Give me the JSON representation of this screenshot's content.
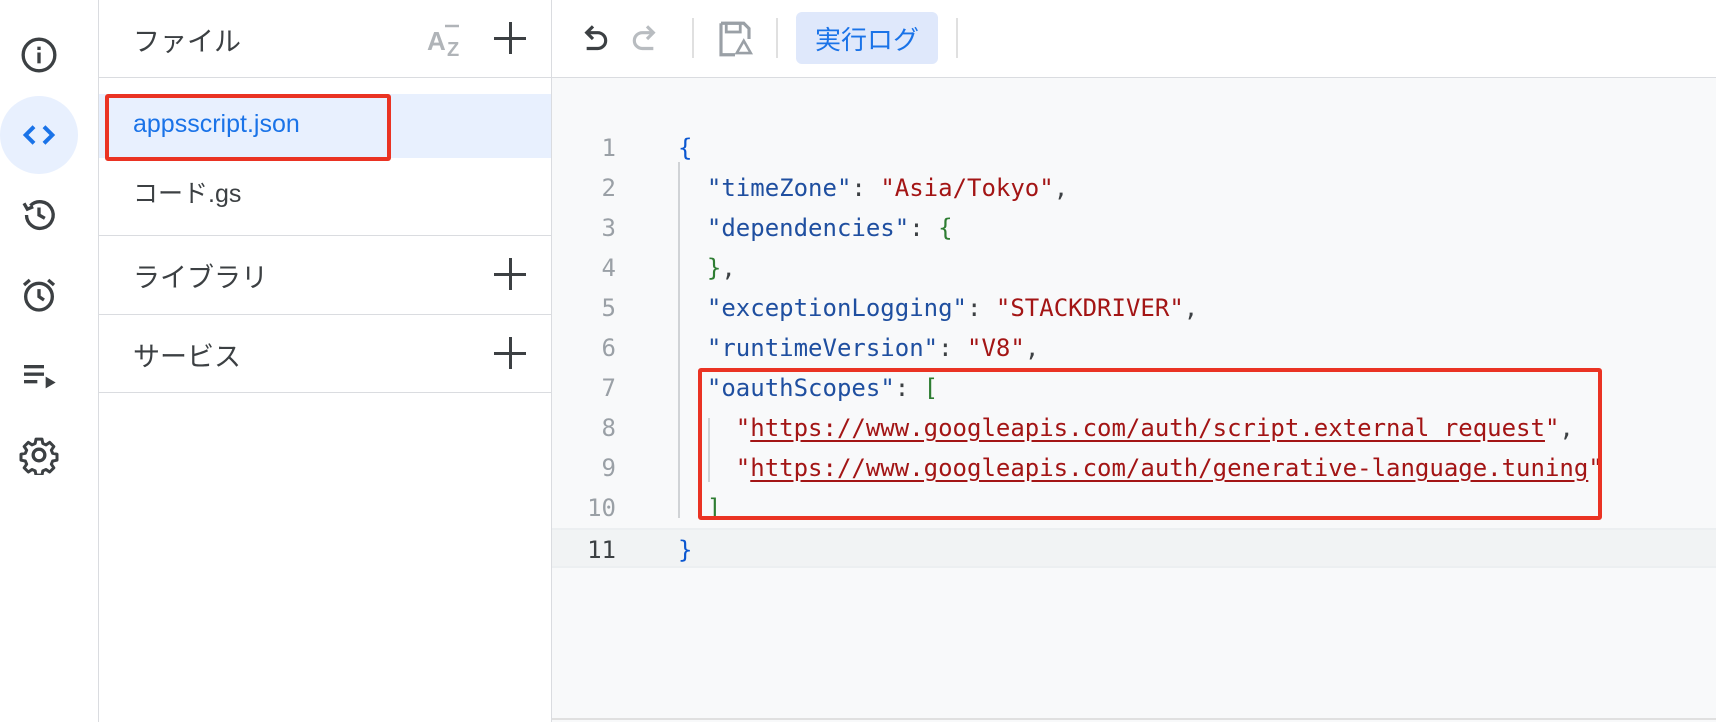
{
  "rail": {
    "items": [
      {
        "name": "overview",
        "icon": "info-icon"
      },
      {
        "name": "editor",
        "icon": "code-icon",
        "active": true
      },
      {
        "name": "history",
        "icon": "history-icon"
      },
      {
        "name": "triggers",
        "icon": "alarm-icon"
      },
      {
        "name": "executions",
        "icon": "playlist-play-icon"
      },
      {
        "name": "settings",
        "icon": "gear-icon"
      }
    ]
  },
  "files_panel": {
    "title": "ファイル",
    "files": [
      {
        "name": "appsscript.json",
        "selected": true
      },
      {
        "name": "コード.gs",
        "selected": false
      }
    ],
    "libraries_title": "ライブラリ",
    "services_title": "サービス"
  },
  "toolbar": {
    "run_log_label": "実行ログ"
  },
  "editor": {
    "current_line": 11,
    "lines": [
      {
        "n": "1"
      },
      {
        "n": "2",
        "key": "timeZone",
        "value": "Asia/Tokyo"
      },
      {
        "n": "3",
        "key": "dependencies"
      },
      {
        "n": "4"
      },
      {
        "n": "5",
        "key": "exceptionLogging",
        "value": "STACKDRIVER"
      },
      {
        "n": "6",
        "key": "runtimeVersion",
        "value": "V8"
      },
      {
        "n": "7",
        "key": "oauthScopes"
      },
      {
        "n": "8",
        "url": "https://www.googleapis.com/auth/script.external_request"
      },
      {
        "n": "9",
        "url": "https://www.googleapis.com/auth/generative-language.tuning"
      },
      {
        "n": "10"
      },
      {
        "n": "11"
      }
    ]
  },
  "colors": {
    "accent": "#1a73e8",
    "highlight": "#ea3323",
    "string": "#a31515",
    "key": "#1f4fa0",
    "bracket": "#2e7d32"
  }
}
